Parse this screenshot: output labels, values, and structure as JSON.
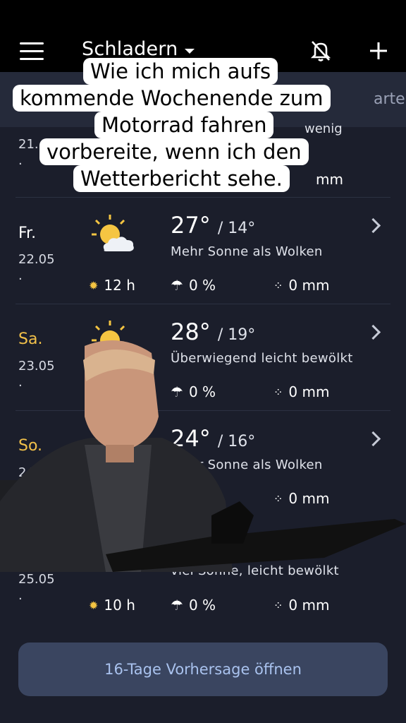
{
  "topbar": {
    "location": "Schladern",
    "menu_icon": "hamburger-menu-icon",
    "bell_icon": "bell-off-icon",
    "add_icon": "plus-icon",
    "partial_tab": "arte"
  },
  "caption": {
    "lines": [
      "Wie ich mich aufs",
      "kommende Wochenende zum",
      "Motorrad fahren",
      "vorbereite, wenn ich den",
      "Wetterbericht sehe."
    ]
  },
  "partial_row": {
    "date": "21.",
    "dot": "·",
    "tail_text": "wenig",
    "precip": "mm"
  },
  "days": [
    {
      "name": "Fr.",
      "weekend": false,
      "date": "22.05",
      "dot": "·",
      "high": "27°",
      "low": "/ 14°",
      "desc": "Mehr Sonne als Wolken",
      "sun": "12 h",
      "rain": "0 %",
      "precip": "0 mm",
      "icon": "sun-cloud-icon"
    },
    {
      "name": "Sa.",
      "weekend": true,
      "date": "23.05",
      "dot": "·",
      "high": "28°",
      "low": "/ 19°",
      "desc": "Überwiegend leicht bewölkt",
      "sun": "",
      "rain": "0 %",
      "precip": "0 mm",
      "icon": "sun-cloud-icon"
    },
    {
      "name": "So.",
      "weekend": true,
      "date": "24.0",
      "dot": "",
      "high": "24°",
      "low": "/ 16°",
      "desc": "Mehr Sonne als Wolken",
      "sun": "",
      "rain": "%",
      "precip": "0 mm",
      "icon": "sun-cloud-icon"
    },
    {
      "name": "",
      "weekend": false,
      "date": "25.05",
      "dot": "·",
      "high": "",
      "low": "",
      "desc": "viel Sonne, leicht bewölkt",
      "sun": "10 h",
      "rain": "0 %",
      "precip": "0 mm",
      "icon": ""
    }
  ],
  "cta": {
    "label": "16-Tage Vorhersage öffnen"
  },
  "colors": {
    "background": "#1b1e2b",
    "weekend": "#f2c14a",
    "button": "#3a4560",
    "button_text": "#a9c2ee"
  }
}
